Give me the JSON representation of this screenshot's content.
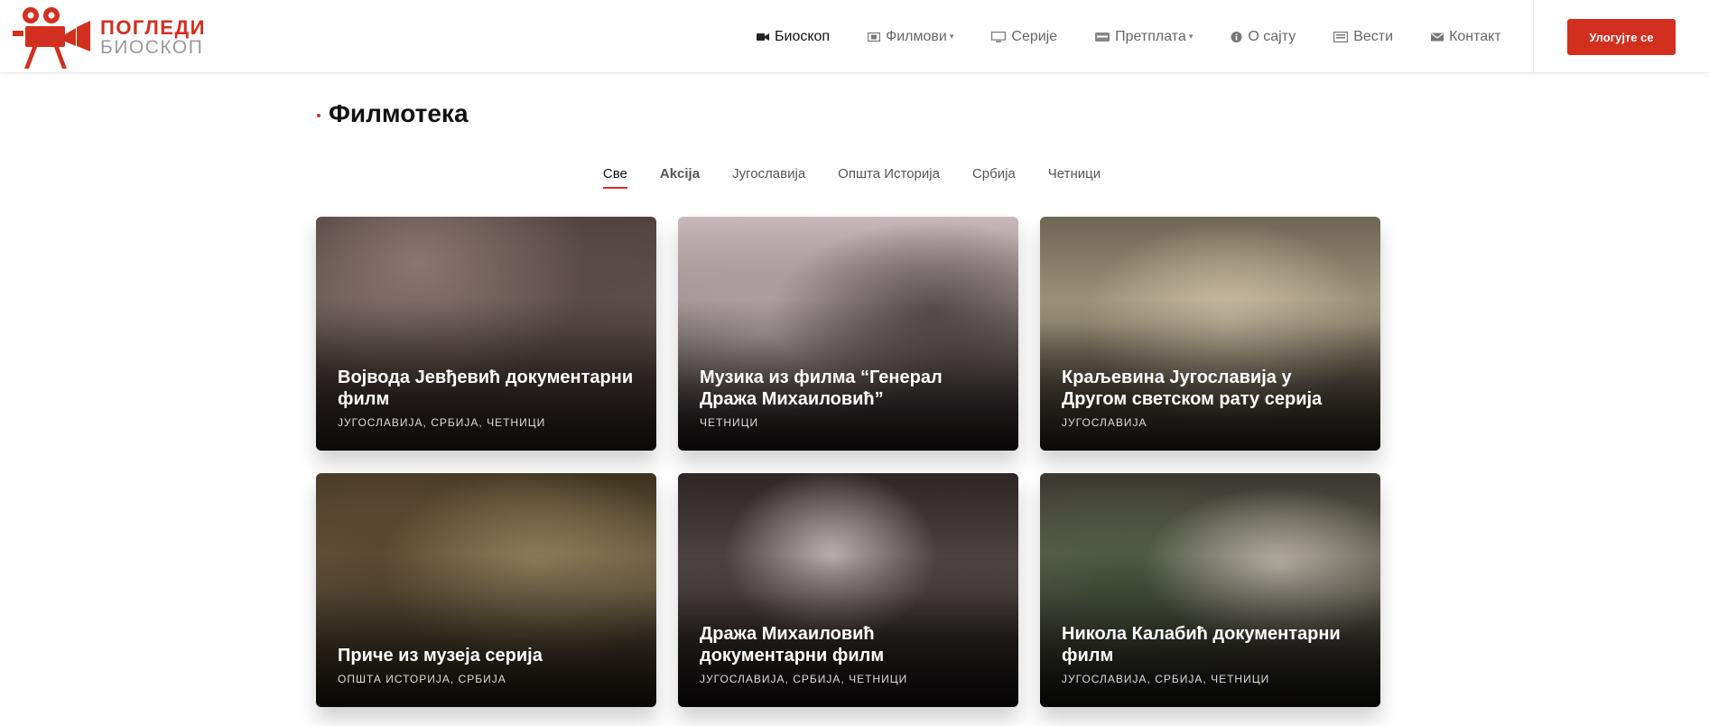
{
  "brand": {
    "name_line1": "ПОГЛЕДИ",
    "name_line2": "БИОСКОП",
    "accent_color": "#d32f1f"
  },
  "nav": {
    "items": [
      {
        "label": "Биоскоп",
        "icon": "video-camera-icon",
        "active": true
      },
      {
        "label": "Филмови",
        "icon": "film-icon",
        "dropdown": true
      },
      {
        "label": "Серије",
        "icon": "monitor-icon"
      },
      {
        "label": "Претплата",
        "icon": "credit-card-icon",
        "dropdown": true
      },
      {
        "label": "О сајту",
        "icon": "info-icon"
      },
      {
        "label": "Вести",
        "icon": "newspaper-icon"
      },
      {
        "label": "Контакт",
        "icon": "envelope-icon"
      }
    ],
    "login_label": "Улогујте се"
  },
  "page": {
    "title": "Филмотека"
  },
  "filters": [
    {
      "label": "Све",
      "active": true
    },
    {
      "label": "Akcija"
    },
    {
      "label": "Југославија"
    },
    {
      "label": "Општа Историја"
    },
    {
      "label": "Србија"
    },
    {
      "label": "Четници"
    }
  ],
  "cards": [
    {
      "title": "Војвода Јевђевић документарни филм",
      "tags": "ЈУГОСЛАВИЈА, СРБИЈА, ЧЕТНИЦИ"
    },
    {
      "title": "Музика из филма “Генерал Дража Михаиловић”",
      "tags": "ЧЕТНИЦИ"
    },
    {
      "title": "Краљевина Југославија у Другом светском рату серија",
      "tags": "ЈУГОСЛАВИЈА"
    },
    {
      "title": "Приче из музеја серија",
      "tags": "ОПШТА ИСТОРИЈА, СРБИЈА"
    },
    {
      "title": "Дража Михаиловић документарни филм",
      "tags": "ЈУГОСЛАВИЈА, СРБИЈА, ЧЕТНИЦИ"
    },
    {
      "title": "Никола Калабић документарни филм",
      "tags": "ЈУГОСЛАВИЈА, СРБИЈА, ЧЕТНИЦИ"
    }
  ]
}
